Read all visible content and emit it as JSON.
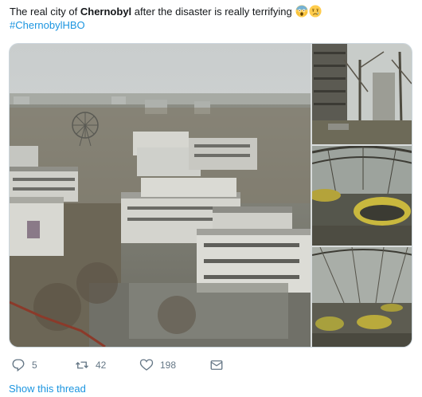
{
  "tweet": {
    "text_before": "The real city of ",
    "text_bold": "Chernobyl",
    "text_after": " after the disaster is really terrifying",
    "emojis": [
      "screaming-face-emoji",
      "crying-face-emoji"
    ],
    "hashtag": "#ChernobylHBO"
  },
  "media": {
    "images": [
      {
        "subject": "aerial view of abandoned city buildings"
      },
      {
        "subject": "abandoned apartment block among trees"
      },
      {
        "subject": "rusted bumper cars under canopy"
      },
      {
        "subject": "bumper cars in overgrown pavilion"
      }
    ]
  },
  "actions": {
    "reply": {
      "icon": "reply-icon",
      "count": "5"
    },
    "retweet": {
      "icon": "retweet-icon",
      "count": "42"
    },
    "like": {
      "icon": "heart-icon",
      "count": "198"
    },
    "dm": {
      "icon": "envelope-icon"
    }
  },
  "show_thread": "Show this thread",
  "colors": {
    "link": "#1b95e0",
    "text": "#14171a",
    "muted": "#657786",
    "border": "#ccd6dd"
  }
}
